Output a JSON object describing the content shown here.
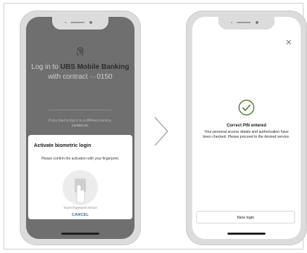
{
  "left_screen": {
    "login_prefix": "Log in to",
    "app_name": "UBS Mobile Banking",
    "contract_text": "with contract ···0150",
    "different_service_text": "If you tried to log in to a different service,",
    "contact_link": "contact us.",
    "dialog": {
      "title": "Activate biometric login",
      "message": "Please confirm the activation with your fingerprint.",
      "sensor_label": "Touch fingerprint sensor",
      "cancel_label": "CANCEL"
    }
  },
  "right_screen": {
    "title": "Correct PIN entered",
    "message": "Your personal access details and authorization have been checked. Please proceed to the desired service.",
    "new_login_label": "New login"
  },
  "icons": {
    "fingerprint": "fingerprint-icon",
    "close": "close-icon",
    "check": "check-circle-icon",
    "arrow": "chevron-right-icon"
  },
  "colors": {
    "dark_overlay": "#6f6f6f",
    "check_accent": "#4a7a2c",
    "link_blue": "#2b6cb0"
  }
}
